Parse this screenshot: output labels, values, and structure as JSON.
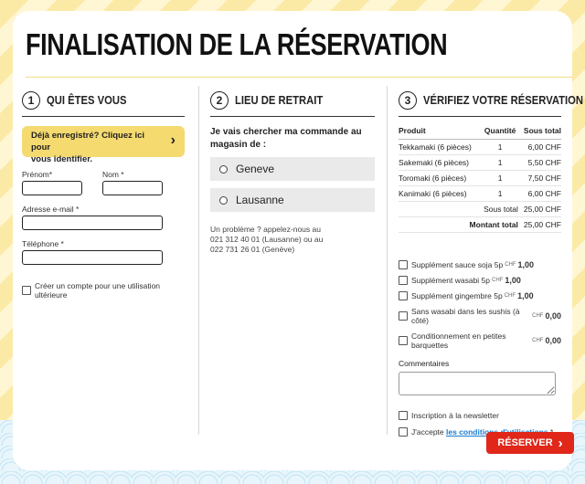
{
  "title": "FINALISATION DE LA RÉSERVATION",
  "step1": {
    "number": "1",
    "title": "QUI ÊTES VOUS",
    "login_prompt_line1": "Déjà enregistré? Cliquez ici pour",
    "login_prompt_line2": "vous identifier.",
    "firstname_label": "Prénom*",
    "lastname_label": "Nom *",
    "email_label": "Adresse e-mail *",
    "phone_label": "Téléphone *",
    "create_account_label": "Créer un compte pour une utilisation ultérieure"
  },
  "step2": {
    "number": "2",
    "title": "LIEU DE RETRAIT",
    "question": "Je vais chercher ma commande au magasin de :",
    "stores": [
      "Geneve",
      "Lausanne"
    ],
    "help_line1": "Un problème ? appelez-nous au",
    "help_line2": "021 312 40 01 (Lausanne) ou au",
    "help_line3": "022 731 26 01 (Genève)"
  },
  "step3": {
    "number": "3",
    "title": "VÉRIFIEZ VOTRE RÉSERVATION",
    "table_headers": {
      "product": "Produit",
      "quantity": "Quantité",
      "subtotal": "Sous total"
    },
    "rows": [
      {
        "product": "Tekkamaki (6 pièces)",
        "qty": "1",
        "price": "6,00 CHF"
      },
      {
        "product": "Sakemaki (6 pièces)",
        "qty": "1",
        "price": "5,50 CHF"
      },
      {
        "product": "Toromaki (6 pièces)",
        "qty": "1",
        "price": "7,50 CHF"
      },
      {
        "product": "Kanimaki (6 pièces)",
        "qty": "1",
        "price": "6,00 CHF"
      }
    ],
    "subtotal_label": "Sous total",
    "subtotal_value": "25,00 CHF",
    "total_label": "Montant total",
    "total_value": "25,00 CHF",
    "options": [
      {
        "label": "Supplément sauce soja 5p",
        "currency": "CHF",
        "price": "1,00"
      },
      {
        "label": "Supplément wasabi 5p",
        "currency": "CHF",
        "price": "1,00"
      },
      {
        "label": "Supplément gingembre 5p",
        "currency": "CHF",
        "price": "1,00"
      },
      {
        "label": "Sans wasabi dans les sushis (à côté)",
        "currency": "CHF",
        "price": "0,00"
      },
      {
        "label": "Conditionnement en petites barquettes",
        "currency": "CHF",
        "price": "0,00"
      }
    ],
    "comments_label": "Commentaires",
    "newsletter_label": "Inscription à la newsletter",
    "accept_prefix": "J'accepte ",
    "accept_link": "les conditions d'utilisations",
    "accept_suffix": " *",
    "submit_label": "RÉSERVER"
  }
}
